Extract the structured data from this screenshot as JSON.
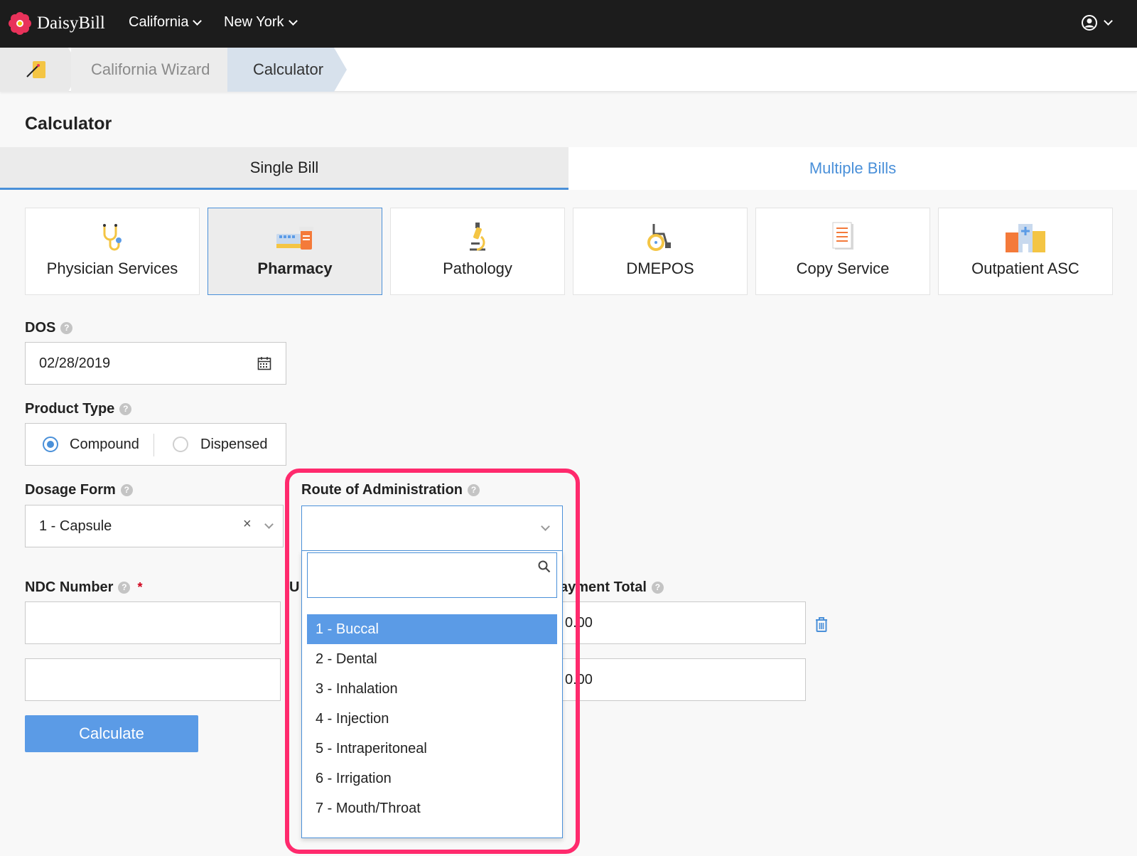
{
  "app": {
    "name": "DaisyBill",
    "brand_color": "#e8325a"
  },
  "nav": {
    "menus": [
      {
        "label": "California"
      },
      {
        "label": "New York"
      }
    ]
  },
  "breadcrumb": {
    "items": [
      "California Wizard",
      "Calculator"
    ]
  },
  "page": {
    "title": "Calculator"
  },
  "tabs": {
    "single": "Single Bill",
    "multiple": "Multiple Bills",
    "active": "Single Bill"
  },
  "services": [
    {
      "label": "Physician Services",
      "icon": "stethoscope-icon"
    },
    {
      "label": "Pharmacy",
      "icon": "pharmacy-icon",
      "active": true
    },
    {
      "label": "Pathology",
      "icon": "microscope-icon"
    },
    {
      "label": "DMEPOS",
      "icon": "wheelchair-icon"
    },
    {
      "label": "Copy Service",
      "icon": "document-icon"
    },
    {
      "label": "Outpatient ASC",
      "icon": "hospital-icon"
    }
  ],
  "form": {
    "dos": {
      "label": "DOS",
      "value": "02/28/2019"
    },
    "product_type": {
      "label": "Product Type",
      "options": [
        "Compound",
        "Dispensed"
      ],
      "selected": "Compound"
    },
    "dosage_form": {
      "label": "Dosage Form",
      "value": "1 - Capsule"
    },
    "route": {
      "label": "Route of Administration",
      "value": ""
    },
    "ndc": {
      "label": "NDC Number",
      "rows": [
        "",
        ""
      ]
    },
    "units_label_fragment": "U",
    "payment_total": {
      "label_fragment": "ay",
      "label_tail": "ment Total",
      "rows": [
        "0.00",
        "0.00"
      ]
    },
    "calculate_label": "Calculate"
  },
  "dropdown": {
    "search_placeholder": "",
    "options": [
      "1 - Buccal",
      "2 - Dental",
      "3 - Inhalation",
      "4 - Injection",
      "5 - Intraperitoneal",
      "6 - Irrigation",
      "7 - Mouth/Throat"
    ],
    "highlighted": "1 - Buccal",
    "highlight_color": "#ff2a6d"
  }
}
